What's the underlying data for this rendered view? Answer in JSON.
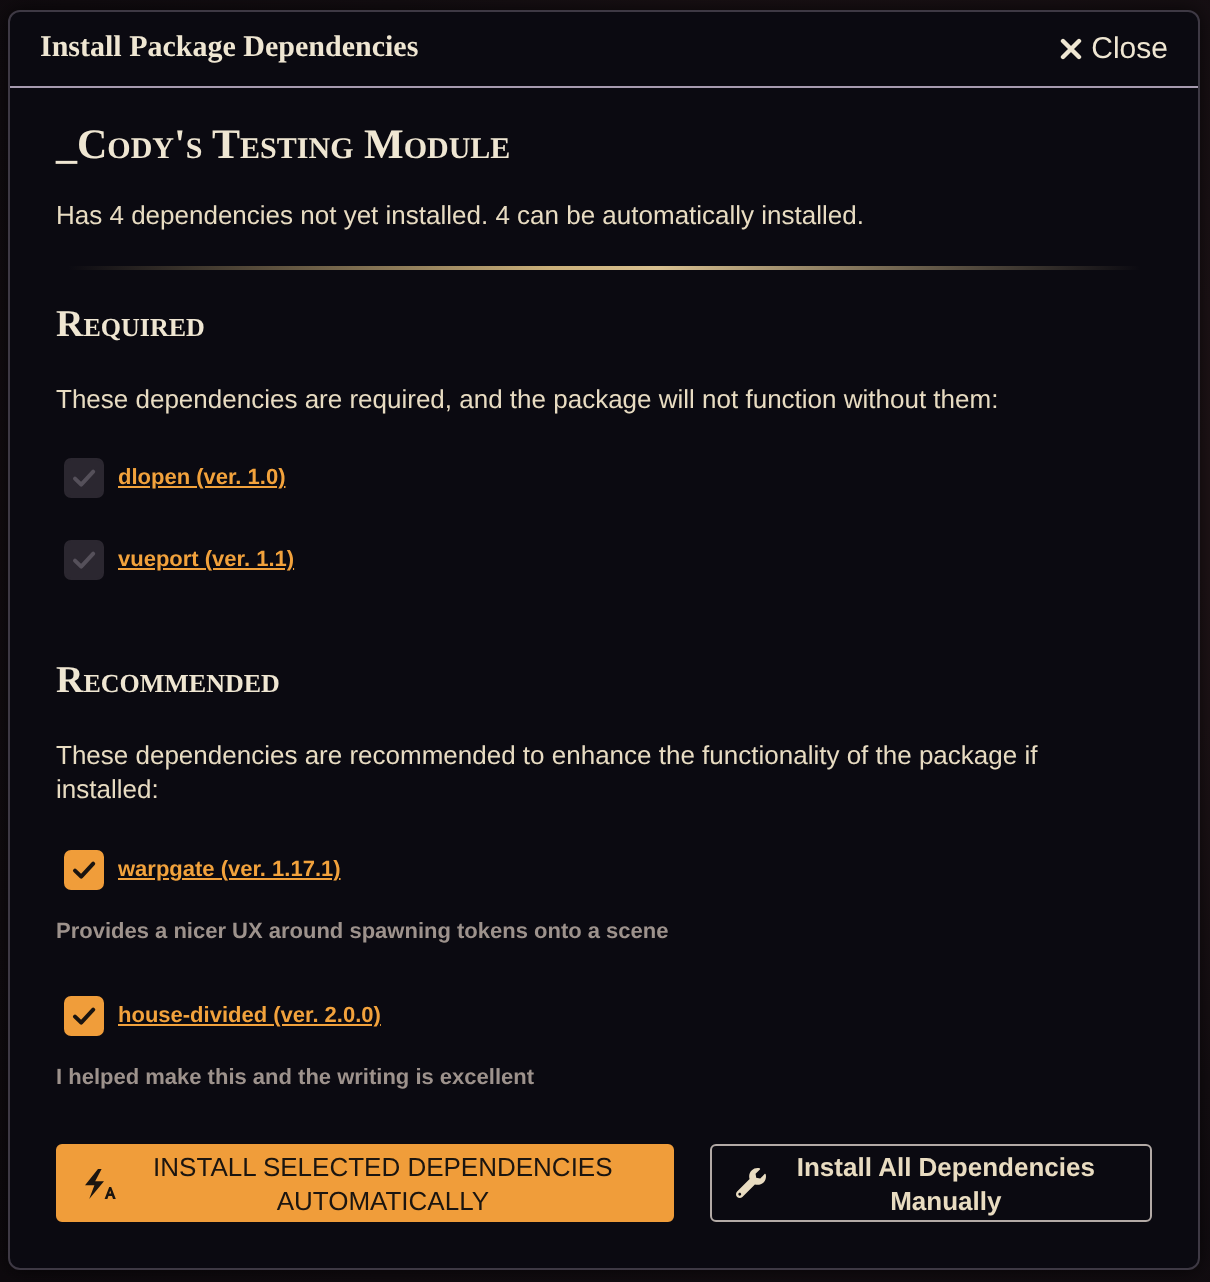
{
  "dialog": {
    "title": "Install Package Dependencies",
    "close_label": "Close"
  },
  "package": {
    "title": "_Cody's Testing Module",
    "summary": "Has 4 dependencies not yet installed. 4 can be automatically installed."
  },
  "sections": [
    {
      "heading": "Required",
      "description": "These dependencies are required, and the package will not function without them:",
      "dependencies": [
        {
          "name": "dlopen (ver. 1.0)",
          "checked": true,
          "disabled": true
        },
        {
          "name": "vueport (ver. 1.1)",
          "checked": true,
          "disabled": true
        }
      ]
    },
    {
      "heading": "Recommended",
      "description": "These dependencies are recommended to enhance the functionality of the package if installed:",
      "dependencies": [
        {
          "name": "warpgate (ver. 1.17.1)",
          "checked": true,
          "disabled": false,
          "note": "Provides a nicer UX around spawning tokens onto a scene"
        },
        {
          "name": "house-divided (ver. 2.0.0)",
          "checked": true,
          "disabled": false,
          "note": "I helped make this and the writing is excellent"
        }
      ]
    }
  ],
  "buttons": [
    {
      "kind": "primary",
      "label": "INSTALL SELECTED DEPENDENCIES AUTOMATICALLY"
    },
    {
      "kind": "secondary",
      "label": "Install All Dependencies Manually"
    }
  ]
}
